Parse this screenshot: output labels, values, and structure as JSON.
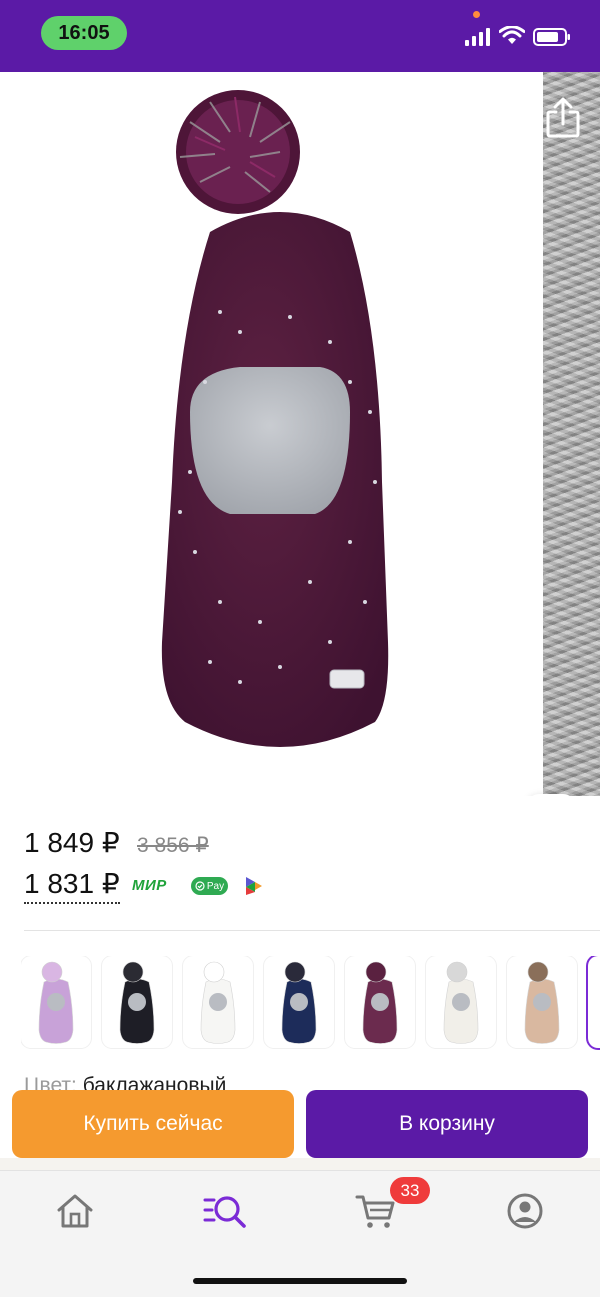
{
  "status_bar": {
    "time": "16:05",
    "colors": {
      "background": "#5b1aa6",
      "time_pill": "#5fd16b"
    }
  },
  "gallery": {
    "icons": [
      "back-icon",
      "heart-icon",
      "share-icon",
      "visual-search-icon"
    ],
    "product_color": "#4f1838"
  },
  "price": {
    "current": "1 849 ₽",
    "old": "3 856 ₽",
    "card": "1 831 ₽",
    "payment_logos": {
      "mir": "МИР",
      "pay": "Pay"
    }
  },
  "variants": [
    {
      "color": "#c8a2d8",
      "pom": "#d9b6e3"
    },
    {
      "color": "#1e1e26",
      "pom": "#2b2b33"
    },
    {
      "color": "#f6f6f4",
      "pom": "#ffffff"
    },
    {
      "color": "#1d2c5a",
      "pom": "#2a2a3a"
    },
    {
      "color": "#6b2b4e",
      "pom": "#5a2140"
    },
    {
      "color": "#f1efe9",
      "pom": "#d8d8d8"
    },
    {
      "color": "#d9b8a0",
      "pom": "#8a6f5a"
    },
    {
      "color": "#ffffff",
      "pom": "#ffffff"
    }
  ],
  "color_row": {
    "label": "Цвет:",
    "value": "баклажановый"
  },
  "actions": {
    "buy_now": "Купить сейчас",
    "to_cart": "В корзину",
    "colors": {
      "buy_now": "#f59a2f",
      "to_cart": "#5b1aa6"
    }
  },
  "tab_bar": {
    "cart_count": "33",
    "icons": [
      "home-icon",
      "catalog-search-icon",
      "cart-icon",
      "profile-icon"
    ],
    "active_color": "#7b2bd6"
  }
}
